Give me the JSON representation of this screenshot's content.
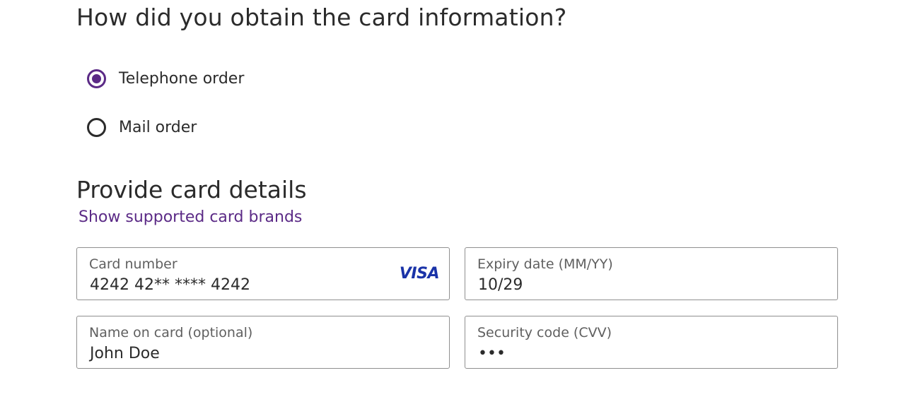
{
  "obtain": {
    "heading": "How did you obtain the card information?",
    "options": [
      {
        "label": "Telephone order",
        "selected": true
      },
      {
        "label": "Mail order",
        "selected": false
      }
    ]
  },
  "card": {
    "heading": "Provide card details",
    "brands_link": "Show supported card brands",
    "fields": {
      "number": {
        "label": "Card number",
        "value": "4242 42** **** 4242",
        "brand": "VISA"
      },
      "expiry": {
        "label": "Expiry date (MM/YY)",
        "value": "10/29"
      },
      "name": {
        "label": "Name on card (optional)",
        "value": "John Doe"
      },
      "cvv": {
        "label": "Security code (CVV)",
        "value": "•••"
      }
    }
  },
  "colors": {
    "accent": "#5b2a86",
    "brand_visa": "#1a33a8",
    "text": "#2b2b2b",
    "border": "#8f8f8f"
  }
}
